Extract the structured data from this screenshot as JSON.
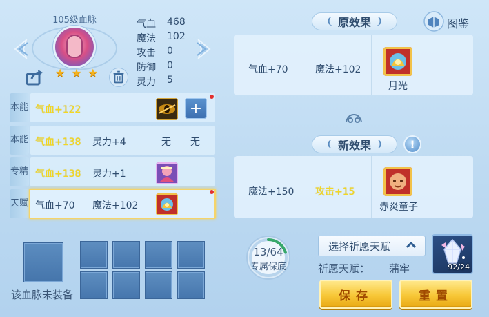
{
  "character": {
    "title": "105级血脉",
    "stars": [
      "★",
      "★",
      "★"
    ]
  },
  "stats": [
    {
      "label": "气血",
      "value": "468"
    },
    {
      "label": "魔法",
      "value": "102"
    },
    {
      "label": "攻击",
      "value": "0"
    },
    {
      "label": "防御",
      "value": "0"
    },
    {
      "label": "灵力",
      "value": "5"
    }
  ],
  "rows": [
    {
      "label": "本能",
      "col1": "气血+122",
      "col2": "",
      "slot1": "",
      "slot2": ""
    },
    {
      "label": "本能",
      "col1": "气血+138",
      "col2": "灵力+4",
      "slot1": "无",
      "slot2": "无"
    },
    {
      "label": "专精",
      "col1": "气血+138",
      "col2": "灵力+1",
      "slot1": "",
      "slot2": ""
    },
    {
      "label": "天赋",
      "col1": "气血+70",
      "col2": "魔法+102",
      "slot1": "",
      "slot2": ""
    }
  ],
  "original_effect": {
    "title": "原效果",
    "effect1": "气血+70",
    "effect2": "魔法+102",
    "icon_name": "月光"
  },
  "new_effect": {
    "title": "新效果",
    "effect1": "魔法+150",
    "effect2": "攻击+15",
    "icon_name": "赤炎童子"
  },
  "catalog_label": "图鉴",
  "equipment": {
    "empty_text": "该血脉未装备"
  },
  "gauge": {
    "text": "13/64",
    "label": "专属保底",
    "progress": 0.203
  },
  "wish": {
    "select_label": "选择祈愿天赋",
    "talent_label": "祈愿天赋：",
    "talent_value": "蒲牢"
  },
  "crystal_count": "92/24",
  "buttons": {
    "save": "保存",
    "reset": "重置"
  },
  "colors": {
    "highlight_text": "#f4d820",
    "gold_button": "#f7c737",
    "panel_bg": "#e2f1fd"
  }
}
